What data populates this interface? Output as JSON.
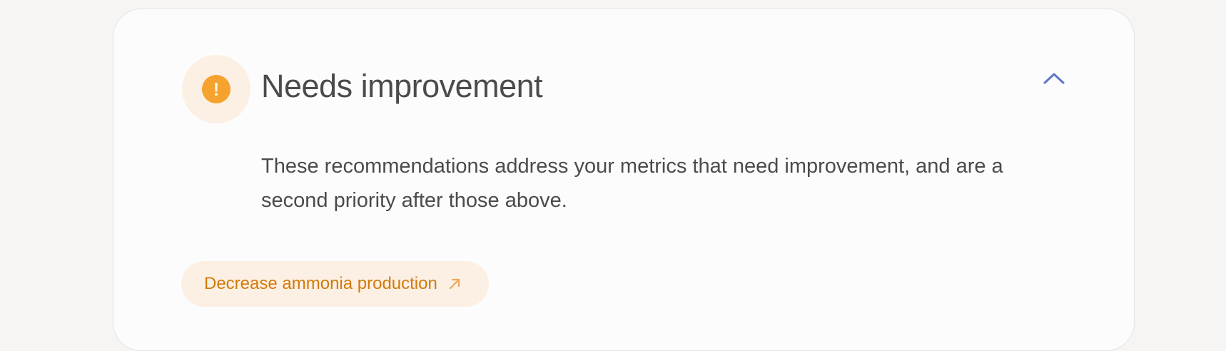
{
  "section": {
    "title": "Needs improvement",
    "status_icon": "exclamation-icon",
    "collapse_icon": "chevron-up-icon",
    "description": "These recommendations address your metrics that need improvement, and are a second priority after those above."
  },
  "recommendations": [
    {
      "label": "Decrease ammonia production",
      "icon": "arrow-up-right-icon"
    }
  ],
  "colors": {
    "page_background": "#f6f5f4",
    "card_background": "#fdfcfc",
    "warning": "#f5a22e",
    "warning_soft": "#fcf0e4",
    "chip_text": "#d27a0a",
    "accent": "#5b77c9",
    "text": "#4b4b4e"
  }
}
